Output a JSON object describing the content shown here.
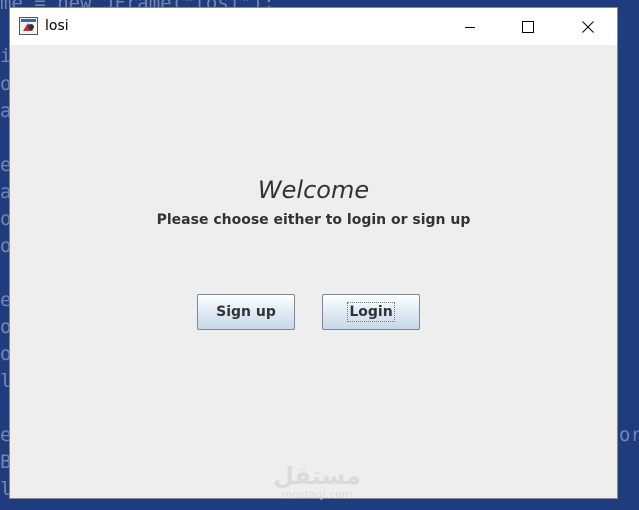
{
  "background_code": [
    "me = new JFrame(\"losi\");",
    "i",
    "o",
    "a",
    "e",
    "a",
    "o",
    "o",
    "e",
    "o",
    "o",
    "l",
    "e",
    "B",
    "l"
  ],
  "background_code_right": "or",
  "window": {
    "title": "losi",
    "controls": [
      "minimize",
      "maximize",
      "close"
    ]
  },
  "content": {
    "heading": "Welcome",
    "subtitle": "Please choose either to login or sign up",
    "buttons": {
      "signup_label": "Sign up",
      "login_label": "Login"
    }
  },
  "watermark": {
    "arabic": "مستقل",
    "latin": "mostaql.com"
  },
  "colors": {
    "desktop_bg": "#1e3c7e",
    "window_bg": "#eeeeee",
    "titlebar_bg": "#ffffff",
    "text": "#333333"
  },
  "icons": [
    "java-app-icon",
    "minimize-icon",
    "maximize-icon",
    "close-icon"
  ]
}
